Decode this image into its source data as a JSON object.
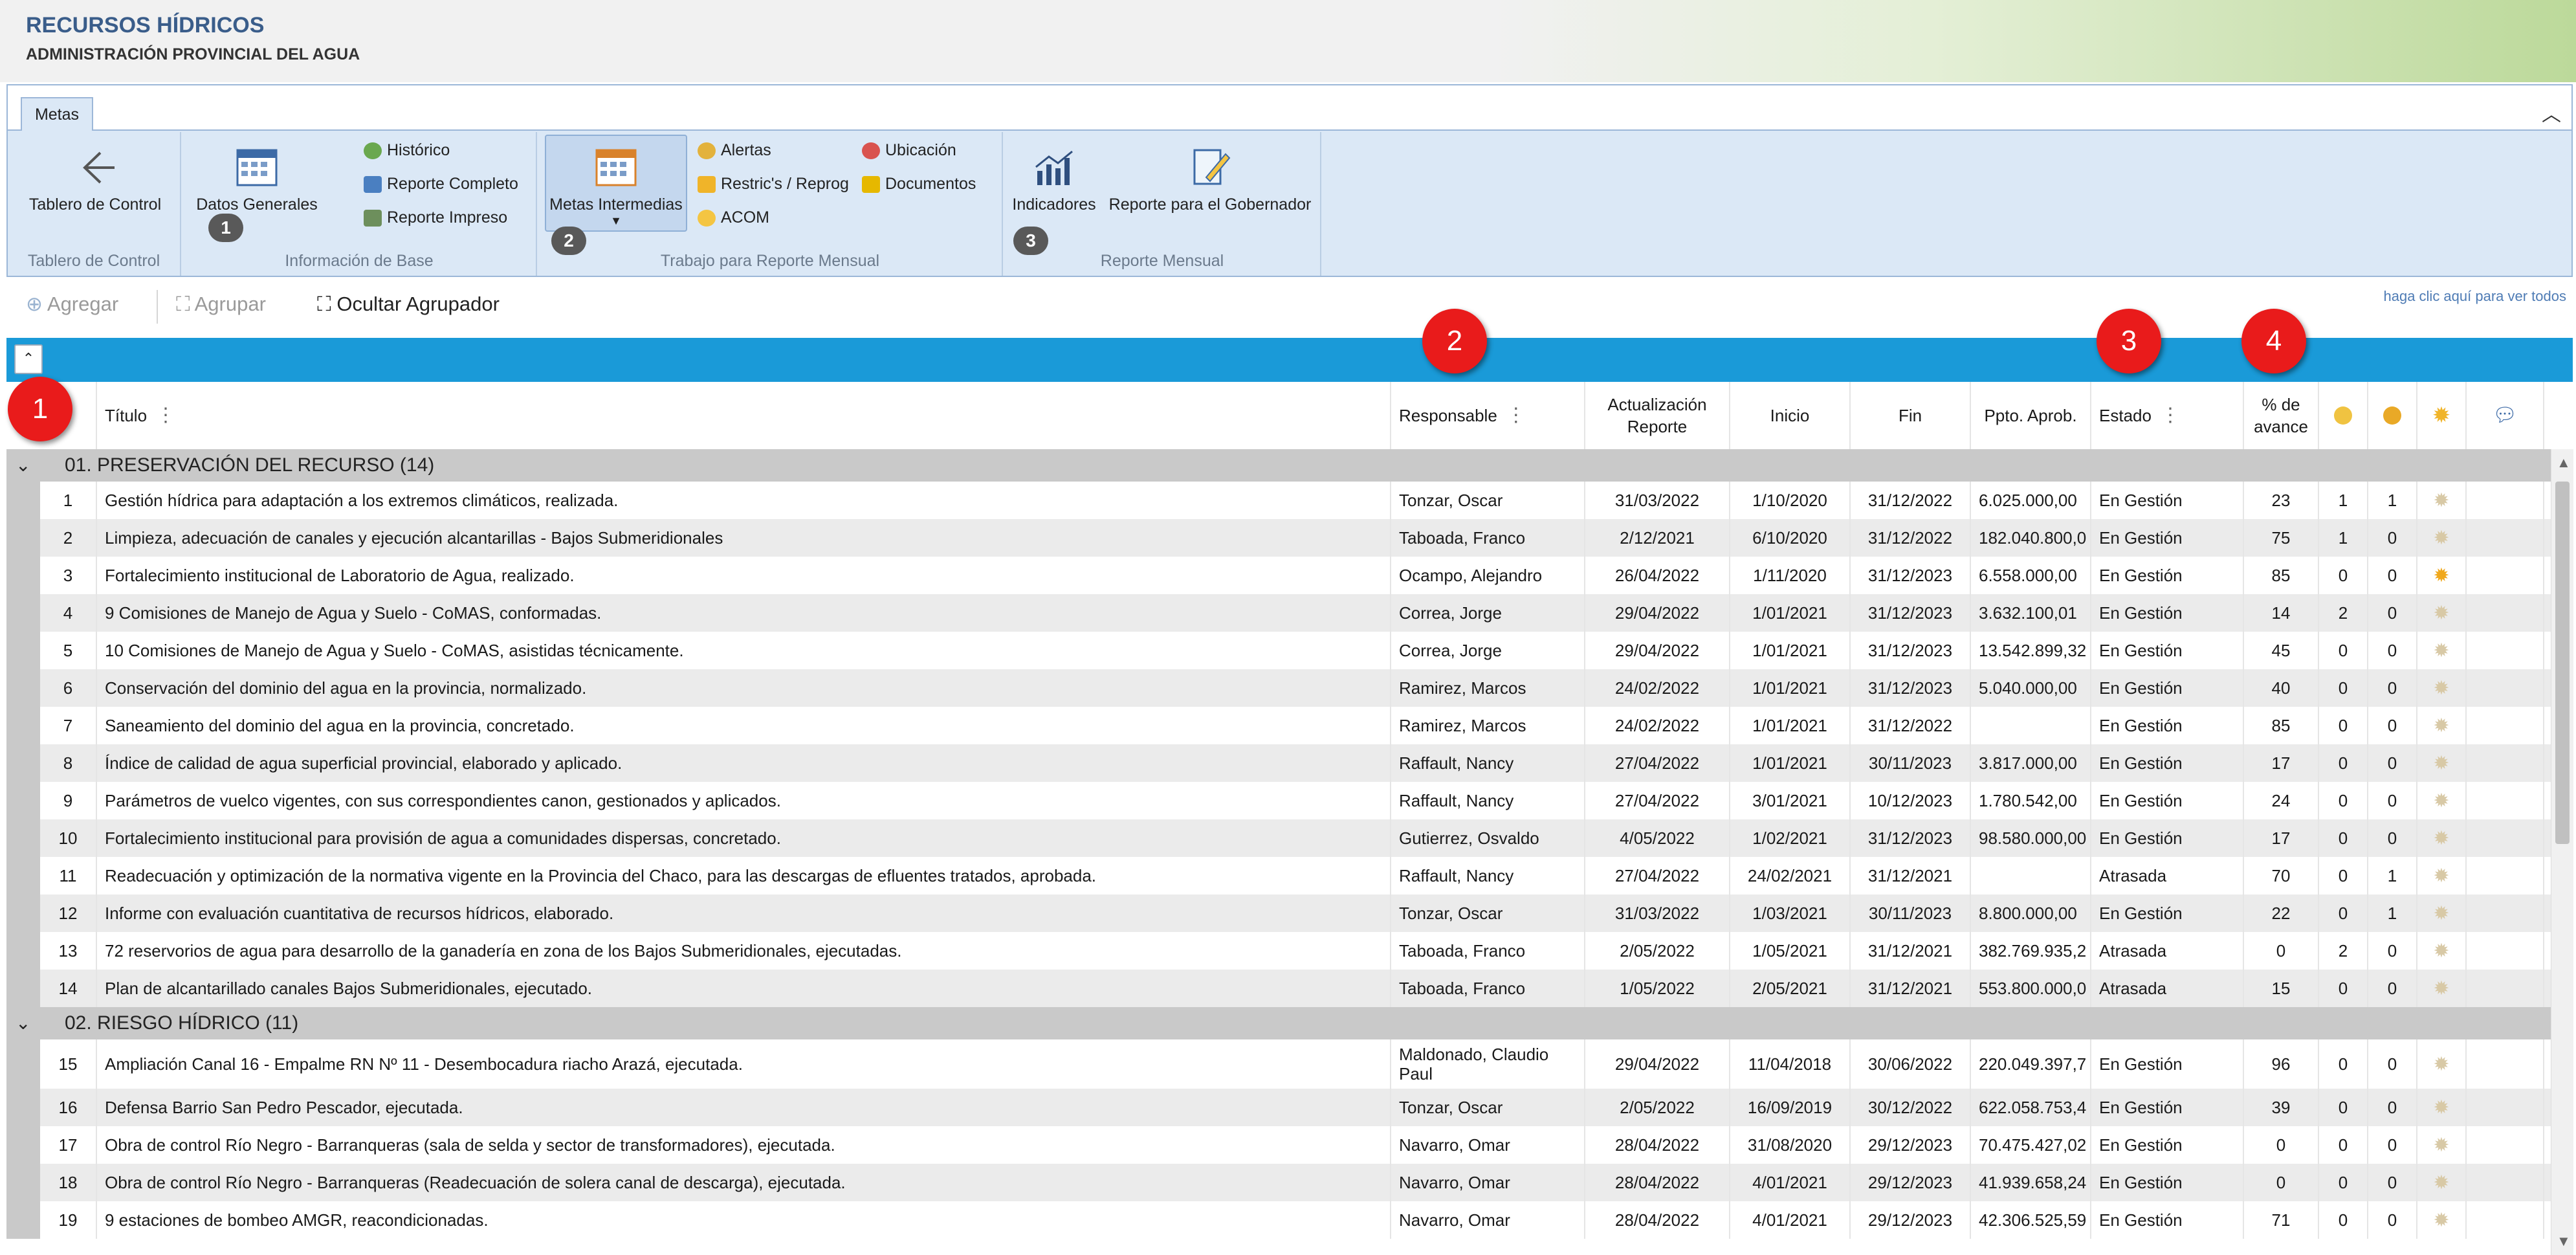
{
  "header": {
    "title": "RECURSOS HÍDRICOS",
    "subtitle": "ADMINISTRACIÓN PROVINCIAL DEL AGUA"
  },
  "ribbon": {
    "tab": "Metas",
    "groups": {
      "tablero": {
        "label": "Tablero de Control",
        "button": "Tablero de Control"
      },
      "info": {
        "label": "Información de Base",
        "badge": "1",
        "button": "Datos Generales",
        "small": [
          "Histórico",
          "Reporte Completo",
          "Reporte Impreso"
        ]
      },
      "trabajo": {
        "label": "Trabajo para Reporte Mensual",
        "badge": "2",
        "button": "Metas Intermedias",
        "small_col1": [
          "Alertas",
          "Restric's / Reprog",
          "ACOM"
        ],
        "small_col2": [
          "Ubicación",
          "Documentos"
        ]
      },
      "reporte": {
        "label": "Reporte Mensual",
        "badge": "3",
        "button1": "Indicadores",
        "button2": "Reporte para el Gobernador"
      }
    }
  },
  "toolbar": {
    "add": "Agregar",
    "group": "Agrupar",
    "hide_group": "Ocultar Agrupador",
    "hint": "haga clic aquí para ver todos"
  },
  "grid": {
    "columns": {
      "title": "Título",
      "responsable": "Responsable",
      "actualizacion": "Actualización Reporte",
      "inicio": "Inicio",
      "fin": "Fin",
      "ppto": "Ppto. Aprob.",
      "estado": "Estado",
      "avance": "% de avance"
    },
    "groups": [
      {
        "label": "01. PRESERVACIÓN DEL RECURSO (14)",
        "rows": [
          {
            "n": "1",
            "t": "Gestión hídrica para adaptación a los extremos climáticos, realizada.",
            "r": "Tonzar, Oscar",
            "a": "31/03/2022",
            "i": "1/10/2020",
            "f": "31/12/2022",
            "p": "6.025.000,00",
            "e": "En Gestión",
            "v": "23",
            "c1": "1",
            "c2": "1",
            "s": "off"
          },
          {
            "n": "2",
            "t": "Limpieza, adecuación de canales y ejecución alcantarillas - Bajos Submeridionales",
            "r": "Taboada, Franco",
            "a": "2/12/2021",
            "i": "6/10/2020",
            "f": "31/12/2022",
            "p": "182.040.800,0",
            "e": "En Gestión",
            "v": "75",
            "c1": "1",
            "c2": "0",
            "s": "off"
          },
          {
            "n": "3",
            "t": "Fortalecimiento institucional de Laboratorio de Agua, realizado.",
            "r": "Ocampo, Alejandro",
            "a": "26/04/2022",
            "i": "1/11/2020",
            "f": "31/12/2023",
            "p": "6.558.000,00",
            "e": "En Gestión",
            "v": "85",
            "c1": "0",
            "c2": "0",
            "s": "on"
          },
          {
            "n": "4",
            "t": "9 Comisiones de Manejo de Agua y Suelo - CoMAS, conformadas.",
            "r": "Correa, Jorge",
            "a": "29/04/2022",
            "i": "1/01/2021",
            "f": "31/12/2023",
            "p": "3.632.100,01",
            "e": "En Gestión",
            "v": "14",
            "c1": "2",
            "c2": "0",
            "s": "off"
          },
          {
            "n": "5",
            "t": "10 Comisiones de Manejo de Agua y Suelo - CoMAS, asistidas técnicamente.",
            "r": "Correa, Jorge",
            "a": "29/04/2022",
            "i": "1/01/2021",
            "f": "31/12/2023",
            "p": "13.542.899,32",
            "e": "En Gestión",
            "v": "45",
            "c1": "0",
            "c2": "0",
            "s": "off"
          },
          {
            "n": "6",
            "t": "Conservación del dominio del agua en la provincia, normalizado.",
            "r": "Ramirez, Marcos",
            "a": "24/02/2022",
            "i": "1/01/2021",
            "f": "31/12/2023",
            "p": "5.040.000,00",
            "e": "En Gestión",
            "v": "40",
            "c1": "0",
            "c2": "0",
            "s": "off"
          },
          {
            "n": "7",
            "t": "Saneamiento del dominio del agua en la provincia, concretado.",
            "r": "Ramirez, Marcos",
            "a": "24/02/2022",
            "i": "1/01/2021",
            "f": "31/12/2022",
            "p": "",
            "e": "En Gestión",
            "v": "85",
            "c1": "0",
            "c2": "0",
            "s": "off"
          },
          {
            "n": "8",
            "t": "Índice de calidad de agua superficial provincial, elaborado y aplicado.",
            "r": "Raffault, Nancy",
            "a": "27/04/2022",
            "i": "1/01/2021",
            "f": "30/11/2023",
            "p": "3.817.000,00",
            "e": "En Gestión",
            "v": "17",
            "c1": "0",
            "c2": "0",
            "s": "off"
          },
          {
            "n": "9",
            "t": "Parámetros de vuelco vigentes, con sus correspondientes canon, gestionados y aplicados.",
            "r": "Raffault, Nancy",
            "a": "27/04/2022",
            "i": "3/01/2021",
            "f": "10/12/2023",
            "p": "1.780.542,00",
            "e": "En Gestión",
            "v": "24",
            "c1": "0",
            "c2": "0",
            "s": "off"
          },
          {
            "n": "10",
            "t": "Fortalecimiento institucional para provisión de agua a comunidades dispersas, concretado.",
            "r": "Gutierrez, Osvaldo",
            "a": "4/05/2022",
            "i": "1/02/2021",
            "f": "31/12/2023",
            "p": "98.580.000,00",
            "e": "En Gestión",
            "v": "17",
            "c1": "0",
            "c2": "0",
            "s": "off"
          },
          {
            "n": "11",
            "t": "Readecuación y optimización de la normativa vigente en la Provincia del Chaco, para las descargas de efluentes tratados, aprobada.",
            "r": "Raffault, Nancy",
            "a": "27/04/2022",
            "i": "24/02/2021",
            "f": "31/12/2021",
            "p": "",
            "e": "Atrasada",
            "v": "70",
            "c1": "0",
            "c2": "1",
            "s": "off"
          },
          {
            "n": "12",
            "t": "Informe con evaluación cuantitativa de recursos hídricos, elaborado.",
            "r": "Tonzar, Oscar",
            "a": "31/03/2022",
            "i": "1/03/2021",
            "f": "30/11/2023",
            "p": "8.800.000,00",
            "e": "En Gestión",
            "v": "22",
            "c1": "0",
            "c2": "1",
            "s": "off"
          },
          {
            "n": "13",
            "t": "72 reservorios de agua para desarrollo de la ganadería en zona de los Bajos Submeridionales, ejecutadas.",
            "r": "Taboada, Franco",
            "a": "2/05/2022",
            "i": "1/05/2021",
            "f": "31/12/2021",
            "p": "382.769.935,2",
            "e": "Atrasada",
            "v": "0",
            "c1": "2",
            "c2": "0",
            "s": "off"
          },
          {
            "n": "14",
            "t": "Plan de alcantarillado canales Bajos Submeridionales, ejecutado.",
            "r": "Taboada, Franco",
            "a": "1/05/2022",
            "i": "2/05/2021",
            "f": "31/12/2021",
            "p": "553.800.000,0",
            "e": "Atrasada",
            "v": "15",
            "c1": "0",
            "c2": "0",
            "s": "off"
          }
        ]
      },
      {
        "label": "02. RIESGO HÍDRICO (11)",
        "rows": [
          {
            "n": "15",
            "t": "Ampliación Canal 16 - Empalme RN Nº 11 - Desembocadura riacho Arazá, ejecutada.",
            "r": "Maldonado, Claudio Paul",
            "a": "29/04/2022",
            "i": "11/04/2018",
            "f": "30/06/2022",
            "p": "220.049.397,7",
            "e": "En Gestión",
            "v": "96",
            "c1": "0",
            "c2": "0",
            "s": "off"
          },
          {
            "n": "16",
            "t": "Defensa Barrio San Pedro Pescador, ejecutada.",
            "r": "Tonzar, Oscar",
            "a": "2/05/2022",
            "i": "16/09/2019",
            "f": "30/12/2022",
            "p": "622.058.753,4",
            "e": "En Gestión",
            "v": "39",
            "c1": "0",
            "c2": "0",
            "s": "off"
          },
          {
            "n": "17",
            "t": "Obra de control Río Negro - Barranqueras (sala de selda y sector de transformadores), ejecutada.",
            "r": "Navarro, Omar",
            "a": "28/04/2022",
            "i": "31/08/2020",
            "f": "29/12/2023",
            "p": "70.475.427,02",
            "e": "En Gestión",
            "v": "0",
            "c1": "0",
            "c2": "0",
            "s": "off"
          },
          {
            "n": "18",
            "t": "Obra de control Río Negro - Barranqueras (Readecuación de solera canal de descarga), ejecutada.",
            "r": "Navarro, Omar",
            "a": "28/04/2022",
            "i": "4/01/2021",
            "f": "29/12/2023",
            "p": "41.939.658,24",
            "e": "En Gestión",
            "v": "0",
            "c1": "0",
            "c2": "0",
            "s": "off"
          },
          {
            "n": "19",
            "t": "9 estaciones de bombeo AMGR, reacondicionadas.",
            "r": "Navarro, Omar",
            "a": "28/04/2022",
            "i": "4/01/2021",
            "f": "29/12/2023",
            "p": "42.306.525,59",
            "e": "En Gestión",
            "v": "71",
            "c1": "0",
            "c2": "0",
            "s": "off"
          }
        ]
      }
    ]
  },
  "callouts": [
    "1",
    "2",
    "3",
    "4"
  ],
  "colors": {
    "blue_bar": "#1a9ad8",
    "callout": "#e91b1b",
    "group_row": "#c9c9c9",
    "title": "#3a5d8a"
  },
  "icons": {
    "back": "arrow-left-icon",
    "table": "calendar-grid-icon",
    "star": "sun-icon",
    "comment": "speech-bubble-icon"
  }
}
